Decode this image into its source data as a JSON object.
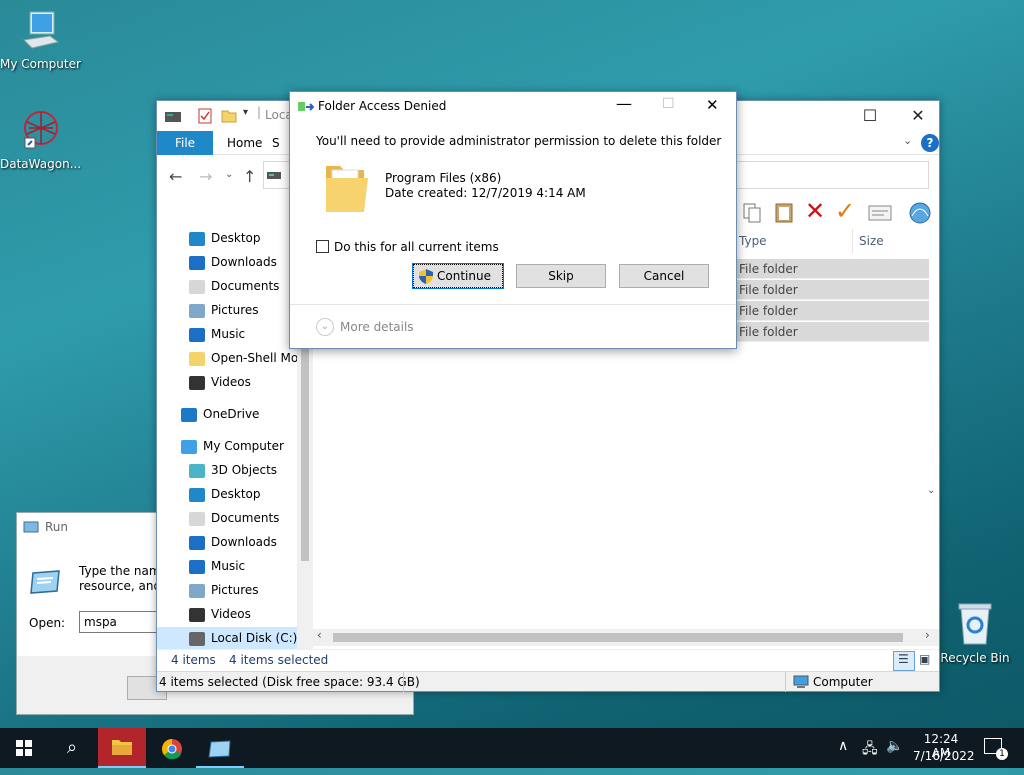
{
  "desktop": {
    "icons": [
      {
        "label": "My Computer"
      },
      {
        "label": "DataWagon..."
      },
      {
        "label": "Recycle Bin"
      }
    ]
  },
  "explorer": {
    "title_path": "Loca",
    "ribbon": {
      "file": "File",
      "home": "Home",
      "share": "S"
    },
    "address_tail": ")",
    "columns": {
      "type": "Type",
      "size": "Size"
    },
    "rows": [
      "File folder",
      "File folder",
      "File folder",
      "File folder"
    ],
    "nav": [
      {
        "label": "Desktop",
        "icon": "desktop-icon"
      },
      {
        "label": "Downloads",
        "icon": "download-icon"
      },
      {
        "label": "Documents",
        "icon": "document-icon"
      },
      {
        "label": "Pictures",
        "icon": "pictures-icon"
      },
      {
        "label": "Music",
        "icon": "music-icon"
      },
      {
        "label": "Open-Shell Mod",
        "icon": "folder-icon"
      },
      {
        "label": "Videos",
        "icon": "video-icon"
      },
      {
        "label": "OneDrive",
        "icon": "cloud-icon"
      },
      {
        "label": "My Computer",
        "icon": "computer-icon"
      },
      {
        "label": "3D Objects",
        "icon": "cube-icon"
      },
      {
        "label": "Desktop",
        "icon": "desktop-icon"
      },
      {
        "label": "Documents",
        "icon": "document-icon"
      },
      {
        "label": "Downloads",
        "icon": "download-icon"
      },
      {
        "label": "Music",
        "icon": "music-icon"
      },
      {
        "label": "Pictures",
        "icon": "pictures-icon"
      },
      {
        "label": "Videos",
        "icon": "video-icon"
      },
      {
        "label": "Local Disk (C:)",
        "icon": "drive-icon"
      }
    ],
    "status": {
      "items": "4 items",
      "selected": "4 items selected",
      "details": "4 items selected (Disk free space: 93.4 GB)",
      "location": "Computer"
    }
  },
  "run": {
    "title": "Run",
    "desc_line1": "Type the name",
    "desc_line2": "resource, and W",
    "open_label": "Open:",
    "open_value": "mspa"
  },
  "dialog": {
    "title": "Folder Access Denied",
    "message": "You'll need to provide administrator permission to delete this folder",
    "item_name": "Program Files (x86)",
    "item_date": "Date created: 12/7/2019 4:14 AM",
    "checkbox_label": "Do this for all current items",
    "continue": "Continue",
    "skip": "Skip",
    "cancel": "Cancel",
    "more_details": "More details"
  },
  "taskbar": {
    "time": "12:24 AM",
    "date": "7/16/2022",
    "notification_count": "1"
  },
  "colors": {
    "accent": "#1e88c8",
    "dialog_border": "#6c8cb2",
    "taskbar": "#0e1922"
  }
}
